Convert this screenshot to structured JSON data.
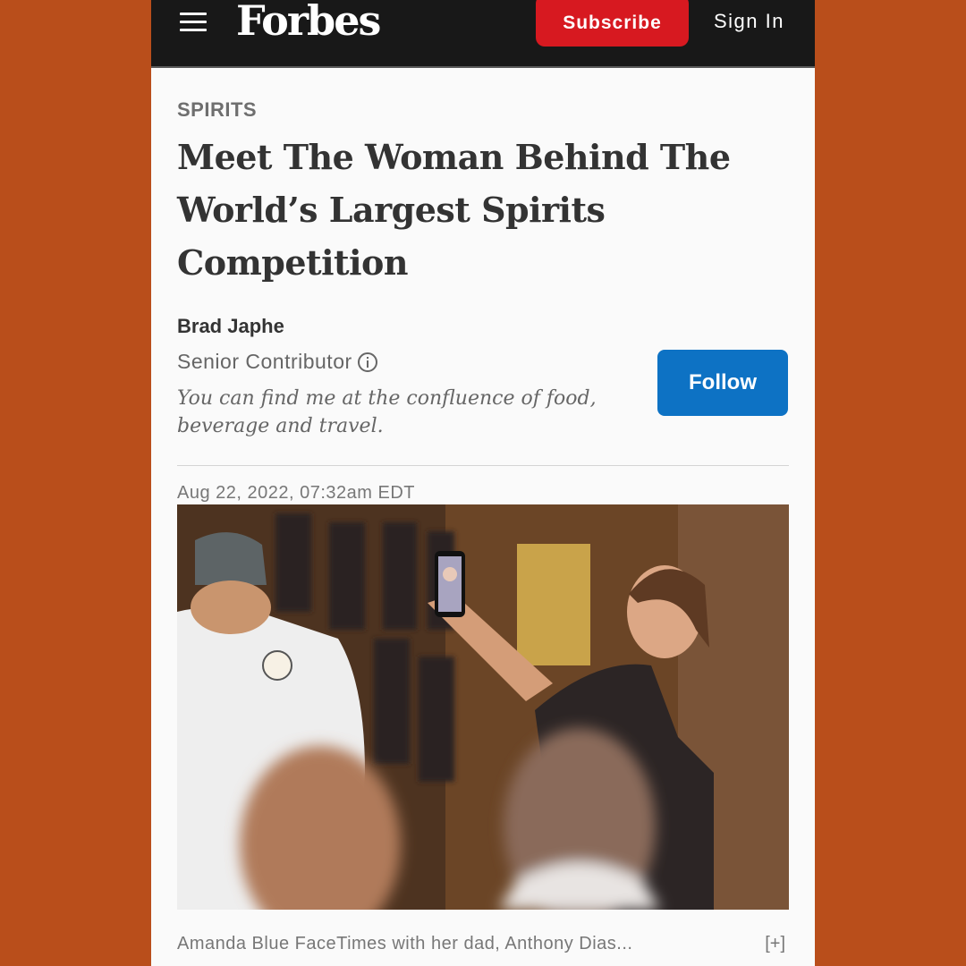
{
  "header": {
    "logo": "Forbes",
    "subscribe_label": "Subscribe",
    "signin_label": "Sign In"
  },
  "article": {
    "section": "SPIRITS",
    "headline_lines": [
      "Meet The Woman Behind The",
      "World’s Largest Spirits",
      "Competition"
    ],
    "author": "Brad Japhe",
    "role": "Senior Contributor",
    "bio_lines": [
      "You can find me at the confluence of food,",
      "beverage and travel."
    ],
    "follow_label": "Follow",
    "date": "Aug 22, 2022,",
    "time": "07:32am EDT",
    "caption": "Amanda Blue FaceTimes with her dad, Anthony Dias...",
    "expand_label": "[+]"
  },
  "colors": {
    "background": "#b94e1b",
    "topbar": "#181818",
    "subscribe": "#d71920",
    "follow": "#0d72c4"
  }
}
